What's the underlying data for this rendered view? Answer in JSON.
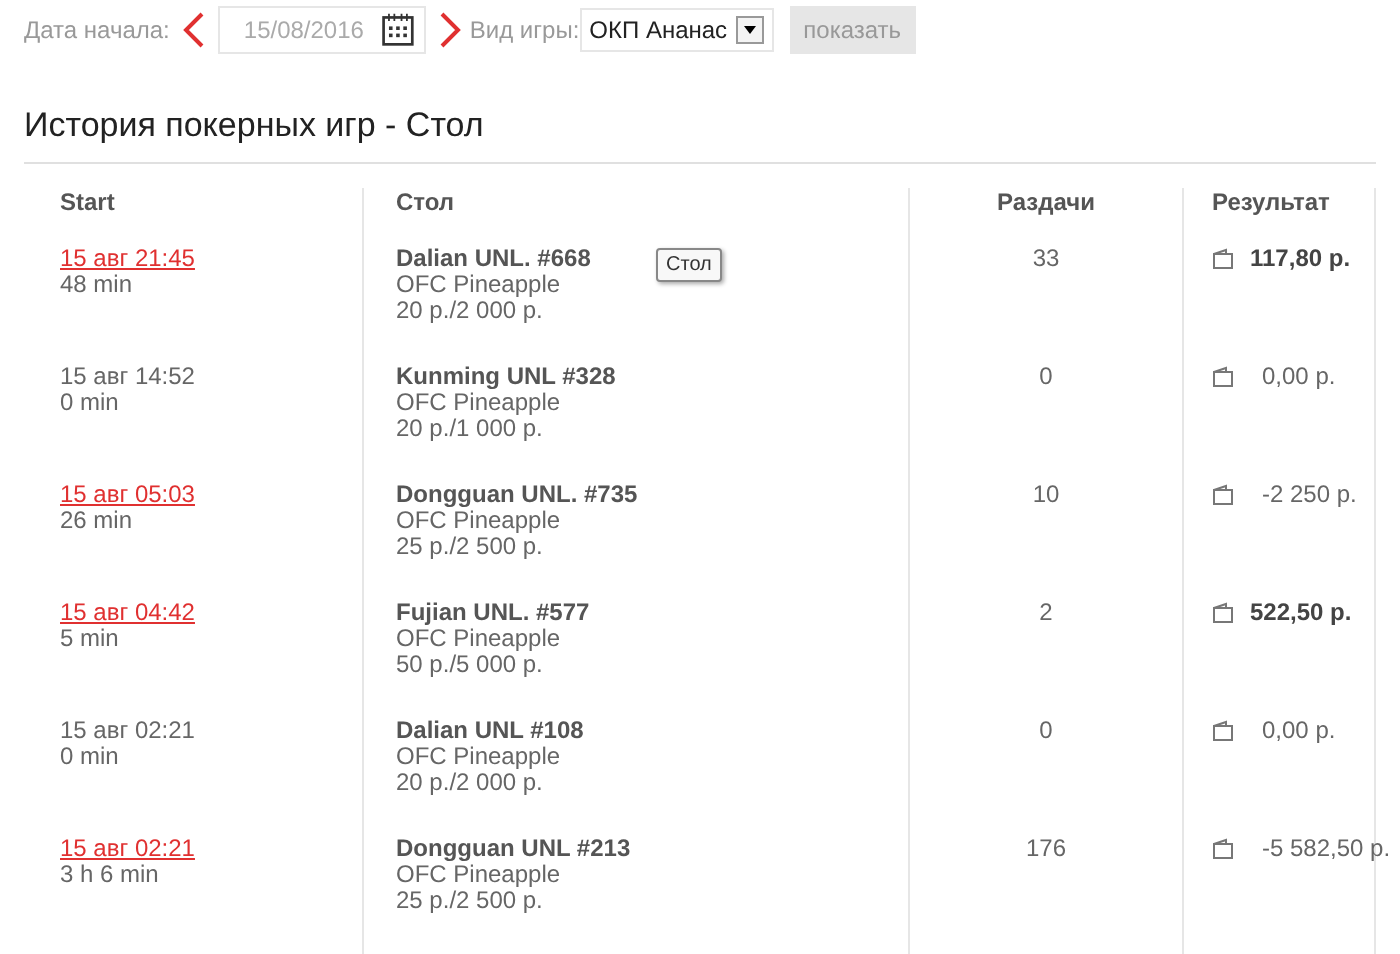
{
  "filter": {
    "date_label": "Дата начала:",
    "date": "15/08/2016",
    "game_label": "Вид игры:",
    "game": "ОКП Ананас",
    "show_button": {
      "label": "показать",
      "disabled": true
    }
  },
  "title": "История покерных игр - Стол",
  "table": {
    "columns": [
      "Start",
      "Стол",
      "Раздачи",
      "Результат"
    ],
    "rows": [
      {
        "start": "15 авг 21:45",
        "linked": true,
        "duration": "48 min",
        "table": "Dalian UNL. #668",
        "game": "OFC Pineapple",
        "stakes": "20 р./2 000 р.",
        "hands": "33",
        "result": "117,80 р.",
        "win": true,
        "tooltip": "Стол"
      },
      {
        "start": "15 авг 14:52",
        "linked": false,
        "duration": "0 min",
        "table": "Kunming UNL #328",
        "game": "OFC Pineapple",
        "stakes": "20 р./1 000 р.",
        "hands": "0",
        "result": "0,00 р.",
        "win": false
      },
      {
        "start": "15 авг 05:03",
        "linked": true,
        "duration": "26 min",
        "table": "Dongguan UNL. #735",
        "game": "OFC Pineapple",
        "stakes": "25 р./2 500 р.",
        "hands": "10",
        "result": "-2 250 р.",
        "win": false
      },
      {
        "start": "15 авг 04:42",
        "linked": true,
        "duration": "5 min",
        "table": "Fujian UNL. #577",
        "game": "OFC Pineapple",
        "stakes": "50 р./5 000 р.",
        "hands": "2",
        "result": "522,50 р.",
        "win": true
      },
      {
        "start": "15 авг 02:21",
        "linked": false,
        "duration": "0 min",
        "table": "Dalian UNL #108",
        "game": "OFC Pineapple",
        "stakes": "20 р./2 000 р.",
        "hands": "0",
        "result": "0,00 р.",
        "win": false
      },
      {
        "start": "15 авг 02:21",
        "linked": true,
        "duration": "3 h 6 min",
        "table": "Dongguan UNL #213",
        "game": "OFC Pineapple",
        "stakes": "25 р./2 500 р.",
        "hands": "176",
        "result": "-5 582,50 р.",
        "win": false
      }
    ]
  }
}
